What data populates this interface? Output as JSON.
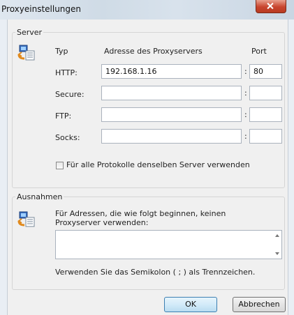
{
  "window": {
    "title": "Proxyeinstellungen"
  },
  "colors": {
    "title_bg": "#d8e2ec",
    "close_button": "#c8452e",
    "default_button_border": "#3c7fb1"
  },
  "server": {
    "legend": "Server",
    "icon": "network-proxy-icon",
    "columns": {
      "type": "Typ",
      "address": "Adresse des Proxyservers",
      "port": "Port"
    },
    "rows": [
      {
        "label": "HTTP:",
        "address": "192.168.1.16",
        "port": "80"
      },
      {
        "label": "Secure:",
        "address": "",
        "port": ""
      },
      {
        "label": "FTP:",
        "address": "",
        "port": ""
      },
      {
        "label": "Socks:",
        "address": "",
        "port": ""
      }
    ],
    "separator": ":",
    "same_server_label": "Für alle Protokolle denselben Server verwenden"
  },
  "exceptions": {
    "legend": "Ausnahmen",
    "icon": "network-proxy-icon",
    "description": "Für Adressen, die wie folgt beginnen, keinen Proxyserver verwenden:",
    "value": "",
    "hint": "Verwenden Sie das Semikolon ( ; ) als Trennzeichen."
  },
  "buttons": {
    "ok": "OK",
    "cancel": "Abbrechen"
  }
}
